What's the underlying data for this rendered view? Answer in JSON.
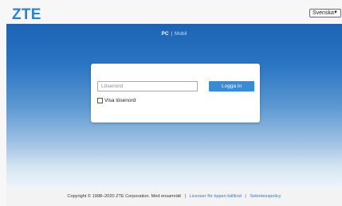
{
  "header": {
    "logo_text": "ZTE",
    "language": "Svenska"
  },
  "view_switch": {
    "pc": "PC",
    "separator": "|",
    "mobile": "Mobil"
  },
  "login": {
    "password_placeholder": "Lösenord",
    "login_button": "Logga in",
    "show_password_label": "Visa lösenord"
  },
  "footer": {
    "copyright": "Copyright © 1998–2020 ZTE Corporation. Med ensamrätt",
    "divider": "|",
    "open_source_link": "Licenser för öppen källkod",
    "privacy_link": "Sekretesspolicy"
  },
  "colors": {
    "brand_blue": "#2a83cf",
    "button_blue": "#3a8bd3",
    "background_top": "#1d63b4"
  }
}
